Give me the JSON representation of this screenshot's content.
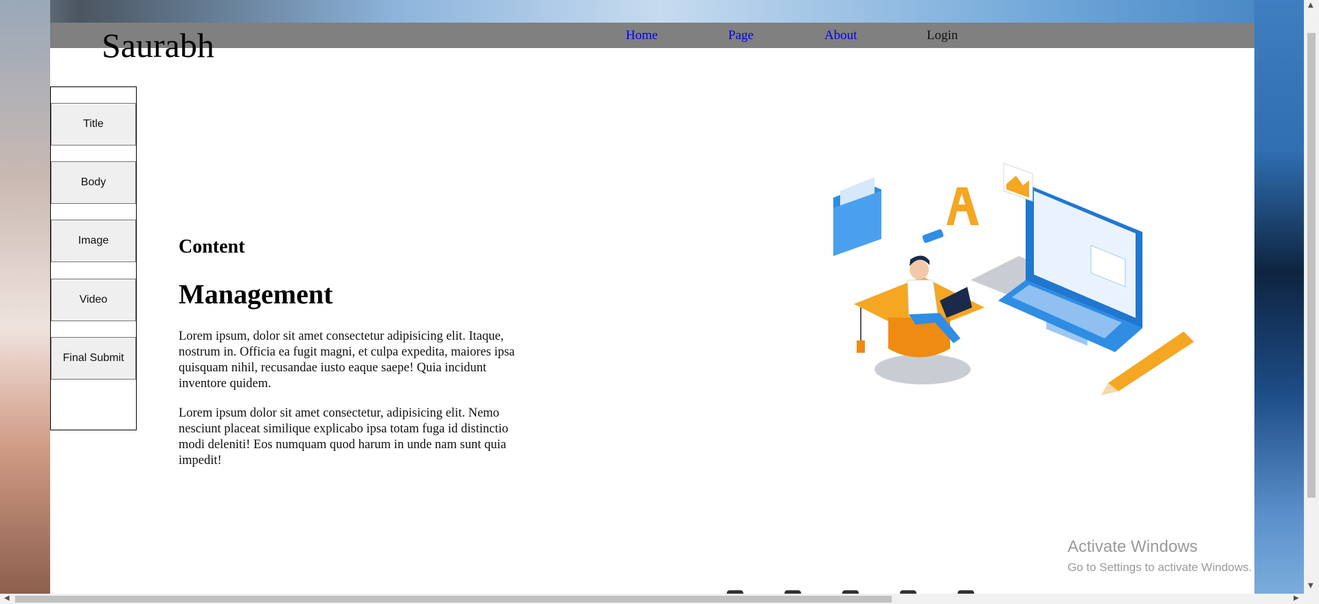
{
  "header": {
    "brand": "Saurabh",
    "nav": [
      {
        "label": "Home"
      },
      {
        "label": "Page"
      },
      {
        "label": "About"
      },
      {
        "label": "Login"
      }
    ]
  },
  "sidebar": {
    "buttons": [
      {
        "label": "Title"
      },
      {
        "label": "Body"
      },
      {
        "label": "Image"
      },
      {
        "label": "Video"
      },
      {
        "label": "Final Submit"
      }
    ]
  },
  "main": {
    "heading_small": "Content",
    "heading_large": "Management",
    "paragraphs": [
      "Lorem ipsum, dolor sit amet consectetur adipisicing elit. Itaque, nostrum in. Officia ea fugit magni, et culpa expedita, maiores ipsa quisquam nihil, recusandae iusto eaque saepe! Quia incidunt inventore quidem.",
      "Lorem ipsum dolor sit amet consectetur, adipisicing elit. Nemo nesciunt placeat similique explicabo ipsa totam fuga id distinctio modi deleniti! Eos numquam quod harum in unde nam sunt quia impedit!"
    ],
    "illustration": "person-on-graduation-cap-with-laptop-illustration"
  },
  "watermark": {
    "title": "Activate Windows",
    "subtitle": "Go to Settings to activate Windows."
  },
  "colors": {
    "navbar": "#808080",
    "link": "#0000ee",
    "accent_blue": "#2f8de4",
    "accent_orange": "#f5a623"
  }
}
